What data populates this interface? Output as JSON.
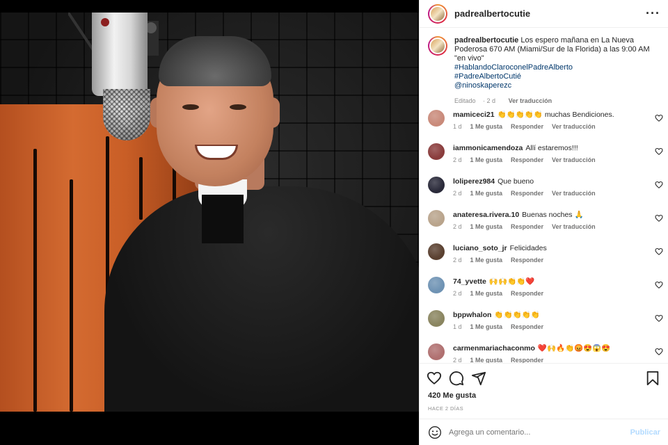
{
  "post": {
    "author": "padrealbertocutie",
    "more_icon": "more-horizontal-icon",
    "caption": {
      "username": "padrealbertocutie",
      "text": "Los espero mañana en La Nueva Poderosa 670 AM (Miami/Sur de la Florida) a las 9:00 AM \"en vivo\"",
      "tags": [
        "#HablandoClaroconelPadreAlberto",
        "#PadreAlbertoCutié",
        "@ninoskaperezc"
      ],
      "edited": "Editado",
      "time": "2 d",
      "translate": "Ver traducción"
    }
  },
  "comments": [
    {
      "username": "mamiceci21",
      "text": "👏👏👏👏👏 muchas Bendiciones.",
      "time": "1 d",
      "likes": "1 Me gusta",
      "reply": "Responder",
      "translate": "Ver traducción",
      "avatar_color": "#c98a7a"
    },
    {
      "username": "iammonicamendoza",
      "text": "Allí estaremos!!!",
      "time": "2 d",
      "likes": "1 Me gusta",
      "reply": "Responder",
      "translate": "Ver traducción",
      "avatar_color": "#8a3c3c"
    },
    {
      "username": "loliperez984",
      "text": "Que bueno",
      "time": "2 d",
      "likes": "1 Me gusta",
      "reply": "Responder",
      "translate": "Ver traducción",
      "avatar_color": "#2a2a3a"
    },
    {
      "username": "anateresa.rivera.10",
      "text": "Buenas noches 🙏",
      "time": "2 d",
      "likes": "1 Me gusta",
      "reply": "Responder",
      "translate": "Ver traducción",
      "avatar_color": "#b9a48c"
    },
    {
      "username": "luciano_soto_jr",
      "text": "Felicidades",
      "time": "2 d",
      "likes": "1 Me gusta",
      "reply": "Responder",
      "translate": "",
      "avatar_color": "#5a4030"
    },
    {
      "username": "74_yvette",
      "text": "🙌🙌👏👏❤️",
      "time": "2 d",
      "likes": "1 Me gusta",
      "reply": "Responder",
      "translate": "",
      "avatar_color": "#6f93b4"
    },
    {
      "username": "bppwhalon",
      "text": "👏👏👏👏👏",
      "time": "1 d",
      "likes": "1 Me gusta",
      "reply": "Responder",
      "translate": "",
      "avatar_color": "#8a8560"
    },
    {
      "username": "carmenmariachaconmo",
      "text": "❤️🙌🔥👏😡😍😱😍",
      "time": "2 d",
      "likes": "1 Me gusta",
      "reply": "Responder",
      "translate": "",
      "avatar_color": "#b07070"
    }
  ],
  "actions": {
    "likes": "420 Me gusta",
    "ago": "HACE 2 DÍAS"
  },
  "add_comment": {
    "placeholder": "Agrega un comentario...",
    "post_label": "Publicar"
  },
  "colors": {
    "link": "#00376b",
    "muted": "#8e8e8e",
    "post_disabled": "#b3dbff"
  }
}
